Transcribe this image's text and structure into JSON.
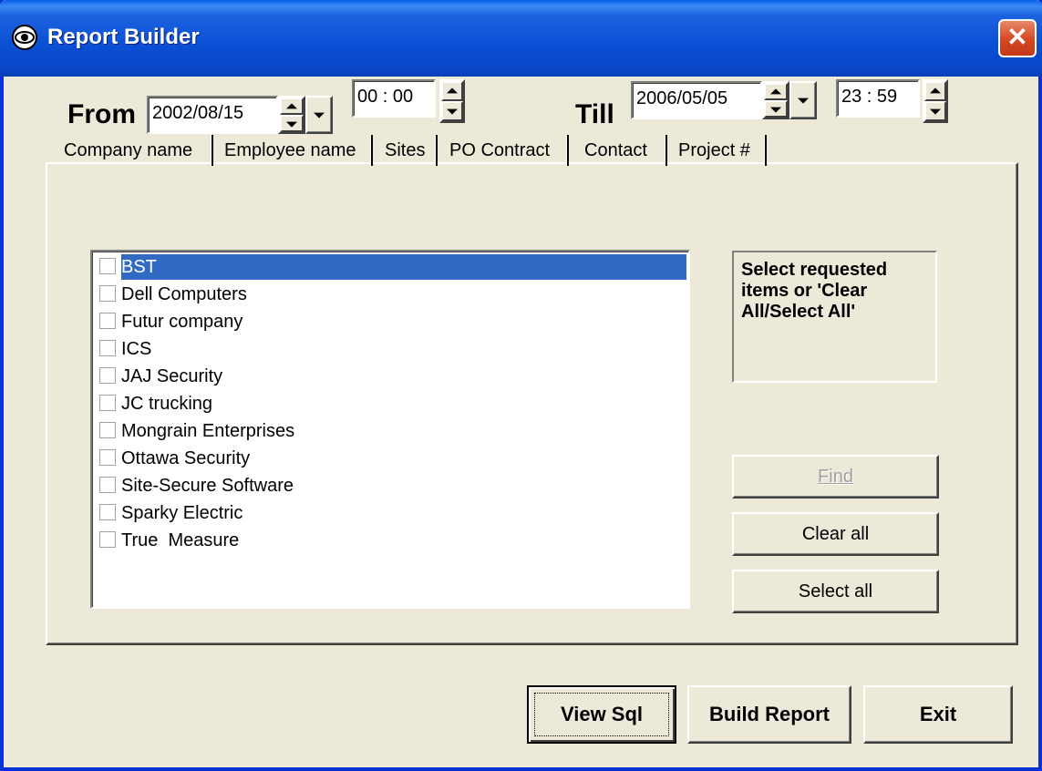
{
  "window": {
    "title": "Report Builder",
    "close_glyph": "✕"
  },
  "range": {
    "from_label": "From",
    "from_date": "2002/08/15",
    "from_time": "00 : 00",
    "till_label": "Till",
    "till_date": "2006/05/05",
    "till_time": "23 : 59"
  },
  "tabs": [
    {
      "label": "Company name",
      "active": true
    },
    {
      "label": "Employee name"
    },
    {
      "label": "Sites"
    },
    {
      "label": "PO Contract"
    },
    {
      "label": "Contact"
    },
    {
      "label": "Project #"
    }
  ],
  "companies": [
    {
      "label": "BST",
      "selected": true,
      "checked": false
    },
    {
      "label": "Dell Computers",
      "checked": false
    },
    {
      "label": "Futur company",
      "checked": false
    },
    {
      "label": "ICS",
      "checked": false
    },
    {
      "label": "JAJ Security",
      "checked": false
    },
    {
      "label": "JC trucking",
      "checked": false
    },
    {
      "label": "Mongrain Enterprises",
      "checked": false
    },
    {
      "label": "Ottawa Security",
      "checked": false
    },
    {
      "label": "Site-Secure Software",
      "checked": false
    },
    {
      "label": "Sparky Electric",
      "checked": false
    },
    {
      "label": "True  Measure",
      "checked": false
    }
  ],
  "hint": "Select requested items or 'Clear All/Select All'",
  "side_buttons": {
    "find": "Find",
    "clear_all": "Clear all",
    "select_all": "Select all"
  },
  "bottom_buttons": {
    "view_sql": "View Sql",
    "build_report": "Build Report",
    "exit": "Exit"
  },
  "colors": {
    "title_bar": "#0a4fd4",
    "selection": "#316ac5",
    "face": "#ece9d8",
    "close": "#d5471f"
  },
  "icons": {
    "app": "eye-icon",
    "close": "close-icon",
    "spin_up": "arrow-up-icon",
    "spin_down": "arrow-down-icon",
    "dropdown": "chevron-down-icon"
  }
}
